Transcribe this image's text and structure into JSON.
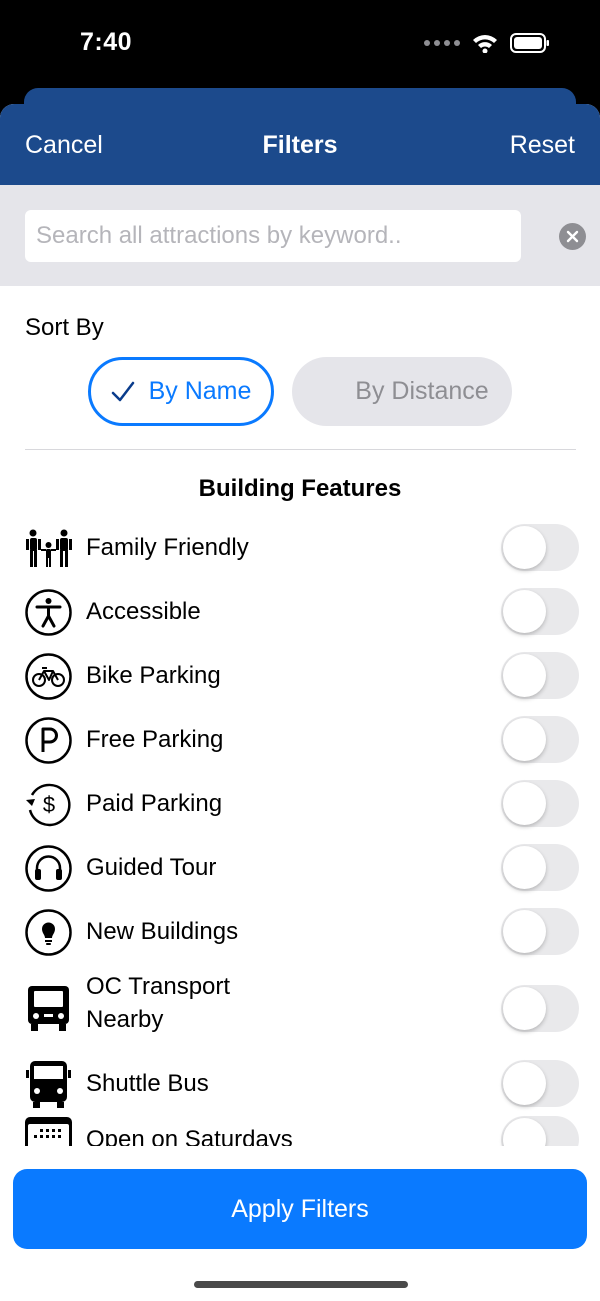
{
  "status_bar": {
    "time": "7:40"
  },
  "nav": {
    "cancel_label": "Cancel",
    "title": "Filters",
    "reset_label": "Reset"
  },
  "search": {
    "placeholder": "Search all attractions by keyword..",
    "value": ""
  },
  "sort": {
    "label": "Sort By",
    "options": [
      {
        "label": "By Name",
        "selected": true
      },
      {
        "label": "By Distance",
        "selected": false
      }
    ]
  },
  "features": {
    "title": "Building Features",
    "items": [
      {
        "label": "Family Friendly",
        "icon": "family-icon",
        "on": false
      },
      {
        "label": "Accessible",
        "icon": "accessibility-icon",
        "on": false
      },
      {
        "label": "Bike Parking",
        "icon": "bicycle-icon",
        "on": false
      },
      {
        "label": "Free Parking",
        "icon": "parking-icon",
        "on": false
      },
      {
        "label": "Paid Parking",
        "icon": "paid-parking-icon",
        "on": false
      },
      {
        "label": "Guided Tour",
        "icon": "headphones-icon",
        "on": false
      },
      {
        "label": "New Buildings",
        "icon": "lightbulb-icon",
        "on": false
      },
      {
        "label": "OC Transport Nearby",
        "icon": "bus-front-icon",
        "on": false
      },
      {
        "label": "Shuttle Bus",
        "icon": "shuttle-bus-icon",
        "on": false
      },
      {
        "label": "Open on Saturdays",
        "icon": "calendar-icon",
        "on": false
      }
    ]
  },
  "apply_label": "Apply Filters",
  "colors": {
    "nav": "#1c4a8c",
    "accent": "#0a7aff",
    "toggle_off": "#e9e9eb"
  }
}
